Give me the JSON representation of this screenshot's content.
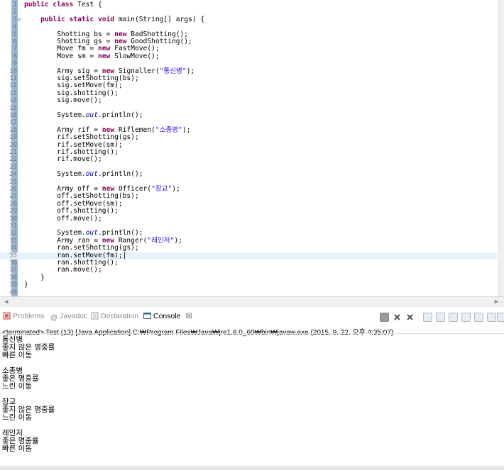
{
  "editor": {
    "lines": [
      {
        "num": "1",
        "code": [
          {
            "t": "public class",
            "c": "kw"
          },
          {
            "t": " Test {"
          }
        ]
      },
      {
        "num": "2",
        "code": []
      },
      {
        "num": "3",
        "code": [
          {
            "t": "    "
          },
          {
            "t": "public static void",
            "c": "kw"
          },
          {
            "t": " main(String[] args) {"
          }
        ]
      },
      {
        "num": "4",
        "code": []
      },
      {
        "num": "5",
        "code": [
          {
            "t": "        Shotting bs = "
          },
          {
            "t": "new",
            "c": "kw"
          },
          {
            "t": " BadShotting();"
          }
        ]
      },
      {
        "num": "6",
        "code": [
          {
            "t": "        Shotting gs = "
          },
          {
            "t": "new",
            "c": "kw"
          },
          {
            "t": " GoodShotting();"
          }
        ]
      },
      {
        "num": "7",
        "code": [
          {
            "t": "        Move fm = "
          },
          {
            "t": "new",
            "c": "kw"
          },
          {
            "t": " FastMove();"
          }
        ]
      },
      {
        "num": "8",
        "code": [
          {
            "t": "        Move sm = "
          },
          {
            "t": "new",
            "c": "kw"
          },
          {
            "t": " SlowMove();"
          }
        ]
      },
      {
        "num": "9",
        "code": []
      },
      {
        "num": "10",
        "code": [
          {
            "t": "        Army sig = "
          },
          {
            "t": "new",
            "c": "kw"
          },
          {
            "t": " Signaller("
          },
          {
            "t": "\"통신병\"",
            "c": "str"
          },
          {
            "t": ");"
          }
        ]
      },
      {
        "num": "11",
        "code": [
          {
            "t": "        sig.setShotting(bs);"
          }
        ]
      },
      {
        "num": "12",
        "code": [
          {
            "t": "        sig.setMove(fm);"
          }
        ]
      },
      {
        "num": "13",
        "code": [
          {
            "t": "        sig.shotting();"
          }
        ]
      },
      {
        "num": "14",
        "code": [
          {
            "t": "        sig.move();"
          }
        ]
      },
      {
        "num": "15",
        "code": []
      },
      {
        "num": "16",
        "code": [
          {
            "t": "        System."
          },
          {
            "t": "out",
            "c": "it"
          },
          {
            "t": ".println();"
          }
        ]
      },
      {
        "num": "17",
        "code": []
      },
      {
        "num": "18",
        "code": [
          {
            "t": "        Army rif = "
          },
          {
            "t": "new",
            "c": "kw"
          },
          {
            "t": " Riflemen("
          },
          {
            "t": "\"소총병\"",
            "c": "str"
          },
          {
            "t": ");"
          }
        ]
      },
      {
        "num": "19",
        "code": [
          {
            "t": "        rif.setShotting(gs);"
          }
        ]
      },
      {
        "num": "20",
        "code": [
          {
            "t": "        rif.setMove(sm);"
          }
        ]
      },
      {
        "num": "21",
        "code": [
          {
            "t": "        rif.shotting();"
          }
        ]
      },
      {
        "num": "22",
        "code": [
          {
            "t": "        rif.move();"
          }
        ]
      },
      {
        "num": "23",
        "code": []
      },
      {
        "num": "24",
        "code": [
          {
            "t": "        System."
          },
          {
            "t": "out",
            "c": "it"
          },
          {
            "t": ".println();"
          }
        ]
      },
      {
        "num": "25",
        "code": []
      },
      {
        "num": "26",
        "code": [
          {
            "t": "        Army off = "
          },
          {
            "t": "new",
            "c": "kw"
          },
          {
            "t": " Officer("
          },
          {
            "t": "\"장교\"",
            "c": "str"
          },
          {
            "t": ");"
          }
        ]
      },
      {
        "num": "27",
        "code": [
          {
            "t": "        off.setShotting(bs);"
          }
        ]
      },
      {
        "num": "28",
        "code": [
          {
            "t": "        off.setMove(sm);"
          }
        ]
      },
      {
        "num": "29",
        "code": [
          {
            "t": "        off.shotting();"
          }
        ]
      },
      {
        "num": "30",
        "code": [
          {
            "t": "        off.move();"
          }
        ]
      },
      {
        "num": "31",
        "code": []
      },
      {
        "num": "32",
        "code": [
          {
            "t": "        System."
          },
          {
            "t": "out",
            "c": "it"
          },
          {
            "t": ".println();"
          }
        ]
      },
      {
        "num": "33",
        "code": [
          {
            "t": "        Army ran = "
          },
          {
            "t": "new",
            "c": "kw"
          },
          {
            "t": " Ranger("
          },
          {
            "t": "\"레인저\"",
            "c": "str"
          },
          {
            "t": ");"
          }
        ]
      },
      {
        "num": "34",
        "code": [
          {
            "t": "        ran.setShotting(gs);"
          }
        ]
      },
      {
        "num": "35",
        "code": [
          {
            "t": "        ran.setMove(fm);|"
          }
        ],
        "highlight": true
      },
      {
        "num": "36",
        "code": [
          {
            "t": "        ran.shotting();"
          }
        ]
      },
      {
        "num": "37",
        "code": [
          {
            "t": "        ran.move();"
          }
        ]
      },
      {
        "num": "38",
        "code": [
          {
            "t": "    }"
          }
        ]
      },
      {
        "num": "39",
        "code": [
          {
            "t": "}"
          }
        ]
      },
      {
        "num": "40",
        "code": []
      }
    ],
    "colors": {
      "keyword": "#7f0055",
      "string": "#2a00ff",
      "field": "#0000c0"
    }
  },
  "tabs": [
    {
      "label": "Problems",
      "icon": "problems-icon",
      "active": false
    },
    {
      "label": "Javadoc",
      "icon": "javadoc-icon",
      "active": false
    },
    {
      "label": "Declaration",
      "icon": "declaration-icon",
      "active": false
    },
    {
      "label": "Console",
      "icon": "console-icon",
      "active": true
    }
  ],
  "console_close": "☒",
  "toolbar_icons": [
    "terminate-icon",
    "remove-launch-icon",
    "remove-all-icon",
    "clear-console-icon",
    "scroll-lock-icon",
    "word-wrap-icon",
    "pin-console-icon",
    "display-console-icon",
    "open-console-icon",
    "minimize-icon",
    "maximize-icon"
  ],
  "status": "<terminated> Test (13) [Java Application] C:₩Program Files₩Java₩jre1.8.0_60₩bin₩javaw.exe (2015. 9. 22. 오후 4:35:07)",
  "console_output": [
    "통신병",
    "좋지 않은 명중률",
    "빠른 이동",
    "",
    "소총병",
    "좋은 명중률",
    "느린 이동",
    "",
    "장교",
    "좋지 않은 명중률",
    "느린 이동",
    "",
    "레인저",
    "좋은 명중률",
    "빠른 이동"
  ]
}
